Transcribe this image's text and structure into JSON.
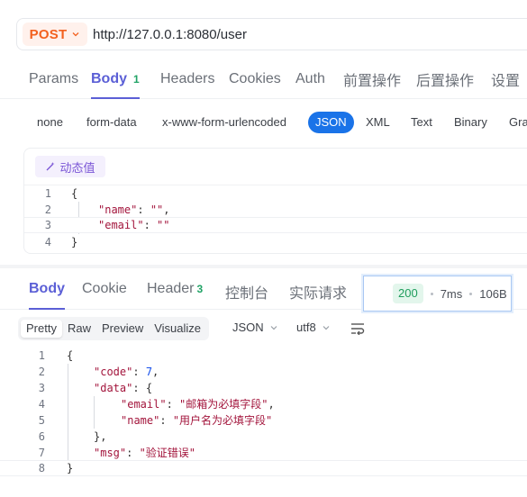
{
  "request": {
    "method": "POST",
    "url": "http://127.0.0.1:8080/user"
  },
  "req_tabs": [
    {
      "label": "Params"
    },
    {
      "label": "Body",
      "count": "1"
    },
    {
      "label": "Headers"
    },
    {
      "label": "Cookies"
    },
    {
      "label": "Auth"
    },
    {
      "label": "前置操作"
    },
    {
      "label": "后置操作"
    },
    {
      "label": "设置"
    }
  ],
  "body_types": [
    "none",
    "form-data",
    "x-www-form-urlencoded",
    "JSON",
    "XML",
    "Text",
    "Binary",
    "Gra"
  ],
  "dynamic_value_label": "动态值",
  "request_body_lines": [
    {
      "n": "1",
      "text": "{"
    },
    {
      "n": "2",
      "key": "\"name\"",
      "sep": ": ",
      "val": "\"\"",
      "end": ","
    },
    {
      "n": "3",
      "key": "\"email\"",
      "sep": ": ",
      "val": "\"\"",
      "end": ""
    },
    {
      "n": "4",
      "text": "}"
    }
  ],
  "resp_tabs": [
    {
      "label": "Body"
    },
    {
      "label": "Cookie"
    },
    {
      "label": "Header",
      "count": "3"
    },
    {
      "label": "控制台"
    },
    {
      "label": "实际请求"
    }
  ],
  "status": {
    "code": "200",
    "time": "7ms",
    "size": "106B"
  },
  "view_modes": [
    "Pretty",
    "Raw",
    "Preview",
    "Visualize"
  ],
  "format_select": "JSON",
  "encoding_select": "utf8",
  "response_lines": [
    {
      "n": "1",
      "indent": 0,
      "text": "{"
    },
    {
      "n": "2",
      "indent": 1,
      "key": "\"code\"",
      "sep": ": ",
      "num": "7",
      "end": ","
    },
    {
      "n": "3",
      "indent": 1,
      "key": "\"data\"",
      "sep": ": ",
      "end": "{"
    },
    {
      "n": "4",
      "indent": 2,
      "key": "\"email\"",
      "sep": ": ",
      "val": "\"邮箱为必填字段\"",
      "end": ","
    },
    {
      "n": "5",
      "indent": 2,
      "key": "\"name\"",
      "sep": ": ",
      "val": "\"用户名为必填字段\"",
      "end": ""
    },
    {
      "n": "6",
      "indent": 1,
      "text": "},"
    },
    {
      "n": "7",
      "indent": 1,
      "key": "\"msg\"",
      "sep": ": ",
      "val": "\"验证错误\"",
      "end": ""
    },
    {
      "n": "8",
      "indent": 0,
      "text": "}"
    }
  ],
  "colors": {
    "accent": "#5b5fd6",
    "method": "#f3611f",
    "json_pill": "#1a73e8",
    "status_ok": "#1f9d5c",
    "string": "#a3153c",
    "number": "#1750eb"
  }
}
